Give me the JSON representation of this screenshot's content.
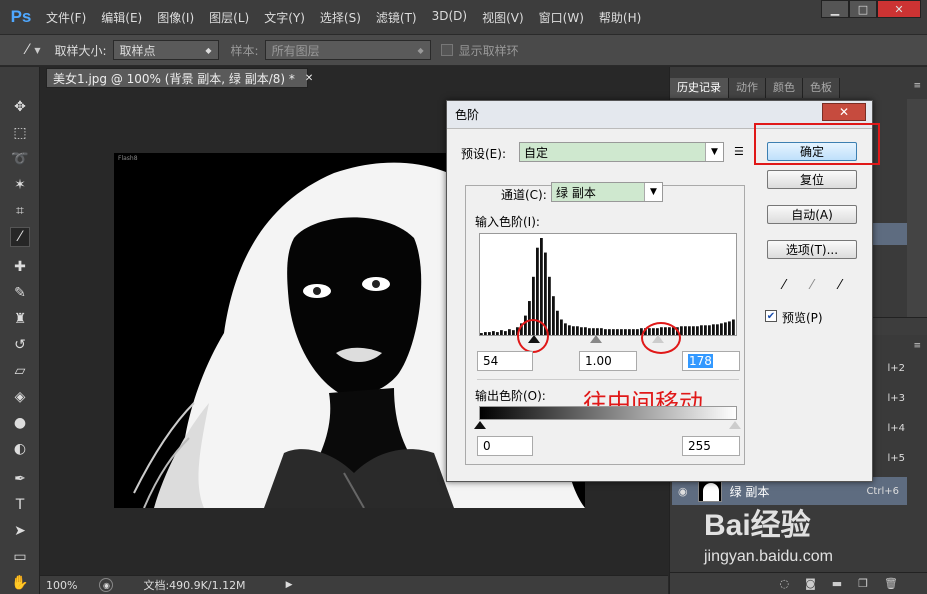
{
  "app": {
    "logo": "Ps",
    "menu": [
      "文件(F)",
      "编辑(E)",
      "图像(I)",
      "图层(L)",
      "文字(Y)",
      "选择(S)",
      "滤镜(T)",
      "3D(D)",
      "视图(V)",
      "窗口(W)",
      "帮助(H)"
    ]
  },
  "options": {
    "sample_size_label": "取样大小:",
    "sample_size_value": "取样点",
    "sample_label": "样本:",
    "sample_value": "所有图层",
    "show_ring_label": "显示取样环"
  },
  "document": {
    "tab_title": "美女1.jpg @ 100% (背景 副本, 绿 副本/8) *",
    "canvas_corner_text": "Flash8",
    "zoom": "100%",
    "doc_info": "文档:490.9K/1.12M"
  },
  "panels": {
    "tabs": [
      "历史记录",
      "动作",
      "颜色",
      "色板"
    ],
    "layer_name": "绿 副本",
    "layer_shortcut": "Ctrl+6",
    "shortcuts": [
      "l+2",
      "l+3",
      "l+4",
      "l+5"
    ]
  },
  "dialog": {
    "title": "色阶",
    "preset_label": "预设(E):",
    "preset_value": "自定",
    "channel_label": "通道(C):",
    "channel_value": "绿 副本",
    "input_levels_label": "输入色阶(I):",
    "input_black": "54",
    "input_gamma": "1.00",
    "input_white": "178",
    "output_levels_label": "输出色阶(O):",
    "output_black": "0",
    "output_white": "255",
    "ok": "确定",
    "reset": "复位",
    "auto": "自动(A)",
    "options": "选项(T)...",
    "preview": "预览(P)",
    "annotation": "往中间移动"
  },
  "watermark": {
    "brand": "Bai经验",
    "url": "jingyan.baidu.com"
  },
  "histogram": {
    "levels": [
      2,
      3,
      3,
      4,
      3,
      5,
      4,
      6,
      5,
      8,
      12,
      20,
      35,
      60,
      90,
      100,
      85,
      60,
      40,
      25,
      16,
      12,
      10,
      9,
      9,
      8,
      8,
      7,
      7,
      7,
      7,
      6,
      6,
      6,
      6,
      6,
      6,
      6,
      6,
      6,
      7,
      7,
      7,
      7,
      7,
      8,
      8,
      8,
      8,
      8,
      9,
      9,
      9,
      9,
      9,
      10,
      10,
      10,
      11,
      11,
      12,
      13,
      14,
      16
    ]
  }
}
